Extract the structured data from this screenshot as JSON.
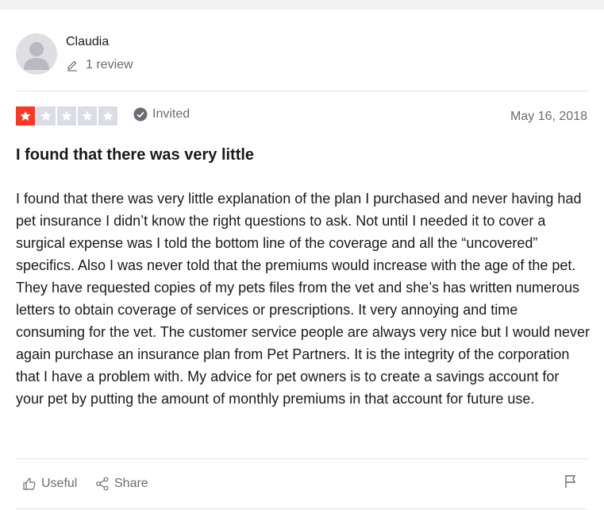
{
  "reviewer": {
    "name": "Claudia",
    "reviews_count": "1 review"
  },
  "rating": {
    "value": 1,
    "max": 5,
    "color": "#ff3722"
  },
  "invited_label": "Invited",
  "date": "May 16, 2018",
  "review": {
    "title": "I found that there was very little",
    "body": "I found that there was very little explanation of the plan I purchased and never having had pet insurance I didn’t know the right questions to ask. Not until I needed it to cover a surgical expense was I told the bottom line of the coverage and all the “uncovered” specifics. Also I was never told that the premiums would increase with the age of the pet. They have requested copies of my pets files from the vet and she’s has written numerous letters to obtain coverage of services or prescriptions. It very annoying and time consuming for the vet. The customer service people are always very nice but I would never again purchase an insurance plan from Pet Partners. It is the integrity of the corporation that I have a problem with. My advice for pet owners is to create a savings account for your pet by putting the amount of monthly premiums in that account for future use."
  },
  "actions": {
    "useful_label": "Useful",
    "share_label": "Share"
  },
  "icons": [
    "avatar-icon",
    "pencil-icon",
    "star-icon",
    "check-badge-icon",
    "thumbs-up-icon",
    "share-icon",
    "flag-icon"
  ]
}
